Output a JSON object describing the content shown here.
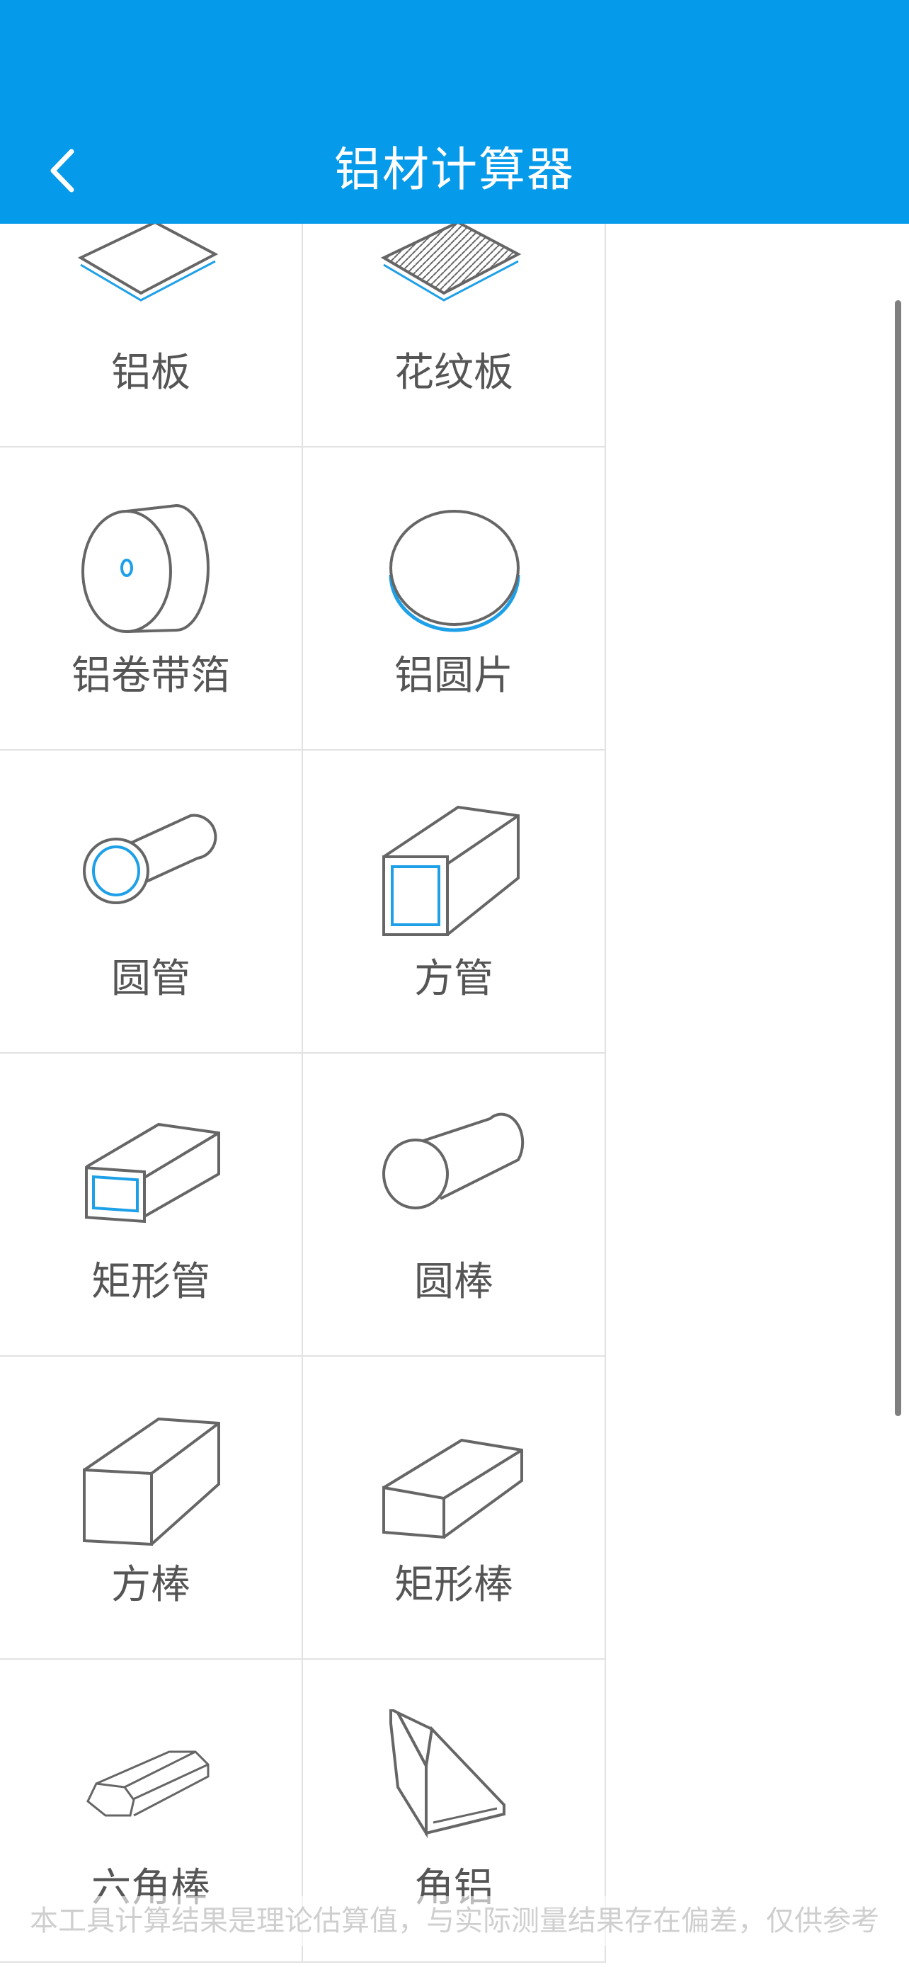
{
  "header": {
    "title": "铝材计算器"
  },
  "items": [
    {
      "label": "铝板",
      "icon": "aluminum-plate-icon"
    },
    {
      "label": "花纹板",
      "icon": "patterned-plate-icon"
    },
    {
      "label": "铝卷带箔",
      "icon": "aluminum-coil-icon"
    },
    {
      "label": "铝圆片",
      "icon": "aluminum-disc-icon"
    },
    {
      "label": "圆管",
      "icon": "round-tube-icon"
    },
    {
      "label": "方管",
      "icon": "square-tube-icon"
    },
    {
      "label": "矩形管",
      "icon": "rectangular-tube-icon"
    },
    {
      "label": "圆棒",
      "icon": "round-bar-icon"
    },
    {
      "label": "方棒",
      "icon": "square-bar-icon"
    },
    {
      "label": "矩形棒",
      "icon": "rectangular-bar-icon"
    },
    {
      "label": "六角棒",
      "icon": "hexagonal-bar-icon"
    },
    {
      "label": "角铝",
      "icon": "angle-aluminum-icon"
    }
  ],
  "footer": {
    "disclaimer": "本工具计算结果是理论估算值，与实际测量结果存在偏差，仅供参考"
  },
  "colors": {
    "header_bg": "#059aea",
    "accent_blue": "#1ea0e8",
    "outline_gray": "#666666",
    "label_gray": "#555555"
  }
}
